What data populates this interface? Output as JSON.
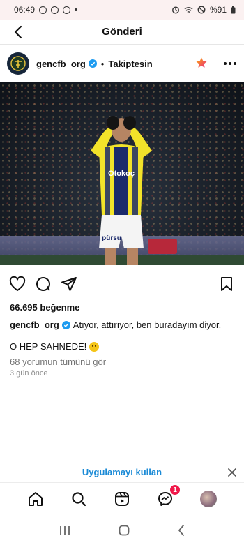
{
  "status_bar": {
    "time": "06:49",
    "battery": "%91"
  },
  "topbar": {
    "title": "Gönderi"
  },
  "post": {
    "username": "gencfb_org",
    "separator": "•",
    "follow_status": "Takiptesin",
    "likes": "66.695 beğenme",
    "caption_text": "Atıyor, attırıyor, ben buradayım diyor.",
    "caption_line2": "O HEP SAHNEDE!",
    "comments_link": "68 yorumun tümünü gör",
    "time_ago": "3 gün önce",
    "jersey_sponsor": "Otokoç",
    "shorts_sponsor": "pürsu"
  },
  "banner": {
    "use_app_label": "Uygulamayı kullan"
  },
  "bottom_nav": {
    "messages_badge": "1"
  },
  "colors": {
    "accent": "#1a8ad6",
    "badge": "#f0194a",
    "verified": "#1d9bf0"
  }
}
